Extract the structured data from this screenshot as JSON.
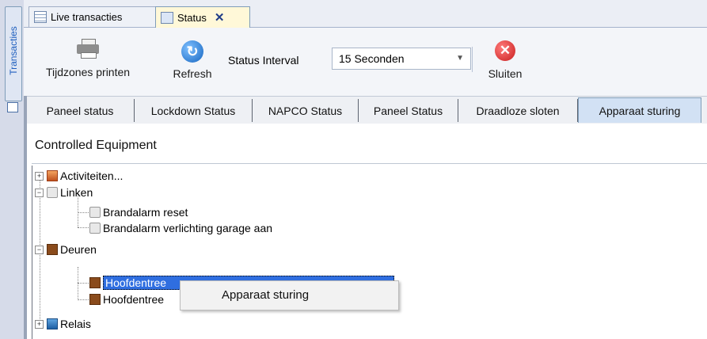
{
  "side_panel": {
    "label": "Transacties"
  },
  "doc_tabs": [
    {
      "label": "Live transacties",
      "icon": "grid-icon"
    },
    {
      "label": "Status",
      "icon": "status-icon",
      "close": "✕"
    }
  ],
  "toolbar": {
    "print_label": "Tijdzones printen",
    "refresh_label": "Refresh",
    "refresh_glyph": "↻",
    "interval_label": "Status Interval",
    "interval_value": "15 Seconden",
    "close_label": "Sluiten",
    "close_glyph": "✕"
  },
  "inner_tabs": [
    "Paneel status",
    "Lockdown Status",
    "NAPCO Status",
    "Paneel Status",
    "Draadloze sloten",
    "Apparaat sturing"
  ],
  "section_title": "Controlled Equipment",
  "tree": {
    "activiteiten": "Activiteiten...",
    "linken": "Linken",
    "brandalarm_reset": "Brandalarm reset",
    "brandalarm_verlichting": "Brandalarm verlichting garage aan",
    "deuren": "Deuren",
    "hoofdentree_1": "Hoofdentree",
    "hoofdentree_2": "Hoofdentree",
    "relais": "Relais",
    "expanded_glyph": "−",
    "collapsed_glyph": "+"
  },
  "context_menu": {
    "item": "Apparaat sturing"
  },
  "colors": {
    "selection": "#2f6ee0",
    "active_tab": "#d2e1f4",
    "close_tab_x": "#1f3c88"
  }
}
